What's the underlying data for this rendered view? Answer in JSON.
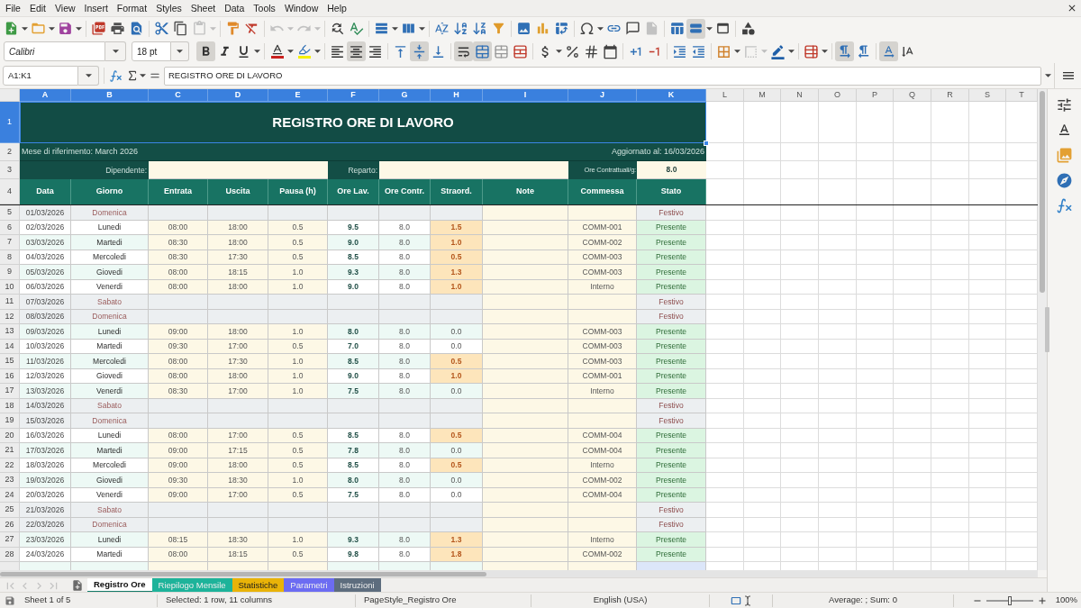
{
  "menu": [
    "File",
    "Edit",
    "View",
    "Insert",
    "Format",
    "Styles",
    "Sheet",
    "Data",
    "Tools",
    "Window",
    "Help"
  ],
  "standard_toolbar": {
    "paste": {
      "disabled": true
    },
    "undo": {
      "disabled": true
    },
    "redo": {
      "disabled": true
    },
    "header_footer": {
      "disabled": true
    },
    "headers": {
      "pressed": false
    },
    "freeze_rows_columns": {
      "pressed": true
    },
    "split_window": {
      "pressed": false
    }
  },
  "formatting_toolbar": {
    "font_name": "Calibri",
    "font_size": "18 pt",
    "bold": {
      "pressed": true
    },
    "italic": {
      "pressed": false
    },
    "underline": {
      "pressed": false
    },
    "align_left": {
      "pressed": false
    },
    "align_center": {
      "pressed": true
    },
    "align_right": {
      "pressed": false
    },
    "align_top": {
      "pressed": false
    },
    "align_middle": {
      "pressed": true
    },
    "align_bottom": {
      "pressed": false
    },
    "wrap_text": {
      "pressed": true
    },
    "merge_center": {
      "pressed": true
    },
    "border_style": {
      "disabled": true
    },
    "paragraph_ltr": {
      "pressed": true
    },
    "paragraph_rtl": {
      "pressed": false
    },
    "text_ltr": {
      "pressed": true
    },
    "text_vertical": {
      "pressed": false
    }
  },
  "formula_bar": {
    "name_box": "A1:K1",
    "content": "REGISTRO ORE DI LAVORO"
  },
  "sheet": {
    "columns": [
      {
        "label": "A",
        "selected": true
      },
      {
        "label": "B",
        "selected": true
      },
      {
        "label": "C",
        "selected": true
      },
      {
        "label": "D",
        "selected": true
      },
      {
        "label": "E",
        "selected": true
      },
      {
        "label": "F",
        "selected": true
      },
      {
        "label": "G",
        "selected": true
      },
      {
        "label": "H",
        "selected": true
      },
      {
        "label": "I",
        "selected": true
      },
      {
        "label": "J",
        "selected": true
      },
      {
        "label": "K",
        "selected": true
      },
      {
        "label": "L",
        "selected": false
      },
      {
        "label": "M",
        "selected": false
      },
      {
        "label": "N",
        "selected": false
      },
      {
        "label": "O",
        "selected": false
      },
      {
        "label": "P",
        "selected": false
      },
      {
        "label": "Q",
        "selected": false
      },
      {
        "label": "R",
        "selected": false
      },
      {
        "label": "S",
        "selected": false
      },
      {
        "label": "T",
        "selected": false
      }
    ],
    "title": {
      "row": "1",
      "selected": true,
      "text": "REGISTRO ORE DI LAVORO"
    },
    "info": {
      "row": "2",
      "selected": false,
      "month": "Mese di riferimento: March 2026",
      "updated": "Aggiornato al: 16/03/2026"
    },
    "employee": {
      "row": "3",
      "selected": false,
      "employee_label": "Dipendente:",
      "department_label": "Reparto:",
      "contract_hours_label": "Ore Contrattuali/g:",
      "contract_hours": "8.0"
    },
    "header": {
      "row": "4",
      "selected": false,
      "labels": [
        "Data",
        "Giorno",
        "Entrata",
        "Uscita",
        "Pausa (h)",
        "Ore Lav.",
        "Ore Contr.",
        "Straord.",
        "Note",
        "Commessa",
        "Stato"
      ]
    },
    "rows": [
      {
        "row": "5",
        "selected": false,
        "kind": "weekend",
        "overtime": false,
        "date": "01/03/2026",
        "day": "Domenica",
        "status": "Festivo"
      },
      {
        "row": "6",
        "selected": false,
        "kind": "work",
        "overtime": true,
        "date": "02/03/2026",
        "day": "Lunedi",
        "entry": "08:00",
        "exit": "18:00",
        "break_hours": "0.5",
        "worked": "9.5",
        "contract": "8.0",
        "overtime_hours": "1.5",
        "job": "COMM-001",
        "status": "Presente"
      },
      {
        "row": "7",
        "selected": false,
        "kind": "work",
        "overtime": true,
        "date": "03/03/2026",
        "day": "Martedi",
        "entry": "08:30",
        "exit": "18:00",
        "break_hours": "0.5",
        "worked": "9.0",
        "contract": "8.0",
        "overtime_hours": "1.0",
        "job": "COMM-002",
        "status": "Presente"
      },
      {
        "row": "8",
        "selected": false,
        "kind": "work",
        "overtime": true,
        "date": "04/03/2026",
        "day": "Mercoledi",
        "entry": "08:30",
        "exit": "17:30",
        "break_hours": "0.5",
        "worked": "8.5",
        "contract": "8.0",
        "overtime_hours": "0.5",
        "job": "COMM-003",
        "status": "Presente"
      },
      {
        "row": "9",
        "selected": false,
        "kind": "work",
        "overtime": true,
        "date": "05/03/2026",
        "day": "Giovedi",
        "entry": "08:00",
        "exit": "18:15",
        "break_hours": "1.0",
        "worked": "9.3",
        "contract": "8.0",
        "overtime_hours": "1.3",
        "job": "COMM-003",
        "status": "Presente"
      },
      {
        "row": "10",
        "selected": false,
        "kind": "work",
        "overtime": true,
        "date": "06/03/2026",
        "day": "Venerdi",
        "entry": "08:00",
        "exit": "18:00",
        "break_hours": "1.0",
        "worked": "9.0",
        "contract": "8.0",
        "overtime_hours": "1.0",
        "job": "Interno",
        "status": "Presente"
      },
      {
        "row": "11",
        "selected": false,
        "kind": "weekend",
        "overtime": false,
        "date": "07/03/2026",
        "day": "Sabato",
        "status": "Festivo"
      },
      {
        "row": "12",
        "selected": false,
        "kind": "weekend",
        "overtime": false,
        "date": "08/03/2026",
        "day": "Domenica",
        "status": "Festivo"
      },
      {
        "row": "13",
        "selected": false,
        "kind": "work",
        "overtime": false,
        "date": "09/03/2026",
        "day": "Lunedi",
        "entry": "09:00",
        "exit": "18:00",
        "break_hours": "1.0",
        "worked": "8.0",
        "contract": "8.0",
        "overtime_hours": "0.0",
        "job": "COMM-003",
        "status": "Presente"
      },
      {
        "row": "14",
        "selected": false,
        "kind": "work",
        "overtime": false,
        "date": "10/03/2026",
        "day": "Martedi",
        "entry": "09:30",
        "exit": "17:00",
        "break_hours": "0.5",
        "worked": "7.0",
        "contract": "8.0",
        "overtime_hours": "0.0",
        "job": "COMM-003",
        "status": "Presente"
      },
      {
        "row": "15",
        "selected": false,
        "kind": "work",
        "overtime": true,
        "date": "11/03/2026",
        "day": "Mercoledi",
        "entry": "08:00",
        "exit": "17:30",
        "break_hours": "1.0",
        "worked": "8.5",
        "contract": "8.0",
        "overtime_hours": "0.5",
        "job": "COMM-003",
        "status": "Presente"
      },
      {
        "row": "16",
        "selected": false,
        "kind": "work",
        "overtime": true,
        "date": "12/03/2026",
        "day": "Giovedi",
        "entry": "08:00",
        "exit": "18:00",
        "break_hours": "1.0",
        "worked": "9.0",
        "contract": "8.0",
        "overtime_hours": "1.0",
        "job": "COMM-001",
        "status": "Presente"
      },
      {
        "row": "17",
        "selected": false,
        "kind": "work",
        "overtime": false,
        "date": "13/03/2026",
        "day": "Venerdi",
        "entry": "08:30",
        "exit": "17:00",
        "break_hours": "1.0",
        "worked": "7.5",
        "contract": "8.0",
        "overtime_hours": "0.0",
        "job": "Interno",
        "status": "Presente"
      },
      {
        "row": "18",
        "selected": false,
        "kind": "weekend",
        "overtime": false,
        "date": "14/03/2026",
        "day": "Sabato",
        "status": "Festivo"
      },
      {
        "row": "19",
        "selected": false,
        "kind": "weekend",
        "overtime": false,
        "date": "15/03/2026",
        "day": "Domenica",
        "status": "Festivo"
      },
      {
        "row": "20",
        "selected": false,
        "kind": "work",
        "overtime": true,
        "date": "16/03/2026",
        "day": "Lunedi",
        "entry": "08:00",
        "exit": "17:00",
        "break_hours": "0.5",
        "worked": "8.5",
        "contract": "8.0",
        "overtime_hours": "0.5",
        "job": "COMM-004",
        "status": "Presente"
      },
      {
        "row": "21",
        "selected": false,
        "kind": "work",
        "overtime": false,
        "date": "17/03/2026",
        "day": "Martedi",
        "entry": "09:00",
        "exit": "17:15",
        "break_hours": "0.5",
        "worked": "7.8",
        "contract": "8.0",
        "overtime_hours": "0.0",
        "job": "COMM-004",
        "status": "Presente"
      },
      {
        "row": "22",
        "selected": false,
        "kind": "work",
        "overtime": true,
        "date": "18/03/2026",
        "day": "Mercoledi",
        "entry": "09:00",
        "exit": "18:00",
        "break_hours": "0.5",
        "worked": "8.5",
        "contract": "8.0",
        "overtime_hours": "0.5",
        "job": "Interno",
        "status": "Presente"
      },
      {
        "row": "23",
        "selected": false,
        "kind": "work",
        "overtime": false,
        "date": "19/03/2026",
        "day": "Giovedi",
        "entry": "09:30",
        "exit": "18:30",
        "break_hours": "1.0",
        "worked": "8.0",
        "contract": "8.0",
        "overtime_hours": "0.0",
        "job": "COMM-002",
        "status": "Presente"
      },
      {
        "row": "24",
        "selected": false,
        "kind": "work",
        "overtime": false,
        "date": "20/03/2026",
        "day": "Venerdi",
        "entry": "09:00",
        "exit": "17:00",
        "break_hours": "0.5",
        "worked": "7.5",
        "contract": "8.0",
        "overtime_hours": "0.0",
        "job": "COMM-004",
        "status": "Presente"
      },
      {
        "row": "25",
        "selected": false,
        "kind": "weekend",
        "overtime": false,
        "date": "21/03/2026",
        "day": "Sabato",
        "status": "Festivo"
      },
      {
        "row": "26",
        "selected": false,
        "kind": "weekend",
        "overtime": false,
        "date": "22/03/2026",
        "day": "Domenica",
        "status": "Festivo"
      },
      {
        "row": "27",
        "selected": false,
        "kind": "work",
        "overtime": true,
        "date": "23/03/2026",
        "day": "Lunedi",
        "entry": "08:15",
        "exit": "18:30",
        "break_hours": "1.0",
        "worked": "9.3",
        "contract": "8.0",
        "overtime_hours": "1.3",
        "job": "Interno",
        "status": "Presente"
      },
      {
        "row": "28",
        "selected": false,
        "kind": "work",
        "overtime": true,
        "date": "24/03/2026",
        "day": "Martedi",
        "entry": "08:00",
        "exit": "18:15",
        "break_hours": "0.5",
        "worked": "9.8",
        "contract": "8.0",
        "overtime_hours": "1.8",
        "job": "COMM-002",
        "status": "Presente"
      },
      {
        "selected": false,
        "kind": "leave",
        "overtime": false
      }
    ]
  },
  "sheet_tabs": [
    {
      "label": "Registro Ore",
      "selected": true,
      "color": "#127a68"
    },
    {
      "label": "Riepilogo Mensile",
      "selected": false,
      "color": "#1db39a"
    },
    {
      "label": "Statistiche",
      "selected": false,
      "color": "#e9b308"
    },
    {
      "label": "Parametri",
      "selected": false,
      "color": "#6c6cf2"
    },
    {
      "label": "Istruzioni",
      "selected": false,
      "color": "#5d6d7e"
    }
  ],
  "status_bar": {
    "sheet": "Sheet 1 of 5",
    "selection": "Selected: 1 row, 11 columns",
    "page_style": "PageStyle_Registro Ore",
    "language": "English (USA)",
    "summary": "Average: ; Sum: 0",
    "zoom_slider": {
      "level": 0.5
    },
    "zoom": "100%"
  }
}
